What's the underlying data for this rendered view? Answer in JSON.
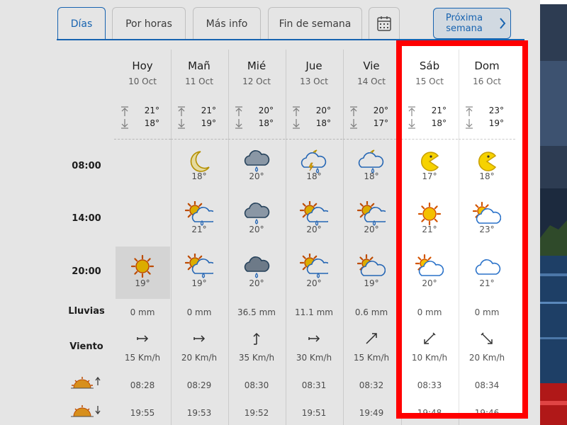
{
  "tabs": [
    {
      "label": "Días",
      "active": true
    },
    {
      "label": "Por horas"
    },
    {
      "label": "Más info"
    },
    {
      "label": "Fin de semana"
    }
  ],
  "next_week": {
    "line1": "Próxima",
    "line2": "semana"
  },
  "row_labels": {
    "h08": "08:00",
    "h14": "14:00",
    "h20": "20:00",
    "rain": "Lluvias",
    "wind": "Viento"
  },
  "days": [
    {
      "name": "Hoy",
      "date": "10 Oct",
      "max": "21°",
      "min": "18°",
      "t08": "",
      "t14": "",
      "t20": "19°",
      "rain": "0 mm",
      "wind": "15 Km/h",
      "sunrise": "08:28",
      "sunset": "19:55"
    },
    {
      "name": "Mañ",
      "date": "11 Oct",
      "max": "21°",
      "min": "19°",
      "t08": "18°",
      "t14": "21°",
      "t20": "19°",
      "rain": "0 mm",
      "wind": "20 Km/h",
      "sunrise": "08:29",
      "sunset": "19:53"
    },
    {
      "name": "Mié",
      "date": "12 Oct",
      "max": "20°",
      "min": "18°",
      "t08": "20°",
      "t14": "20°",
      "t20": "20°",
      "rain": "36.5 mm",
      "wind": "35 Km/h",
      "sunrise": "08:30",
      "sunset": "19:52"
    },
    {
      "name": "Jue",
      "date": "13 Oct",
      "max": "20°",
      "min": "18°",
      "t08": "18°",
      "t14": "20°",
      "t20": "20°",
      "rain": "11.1 mm",
      "wind": "30 Km/h",
      "sunrise": "08:31",
      "sunset": "19:51"
    },
    {
      "name": "Vie",
      "date": "14 Oct",
      "max": "20°",
      "min": "17°",
      "t08": "18°",
      "t14": "20°",
      "t20": "19°",
      "rain": "0.6 mm",
      "wind": "15 Km/h",
      "sunrise": "08:32",
      "sunset": "19:49"
    },
    {
      "name": "Sáb",
      "date": "15 Oct",
      "max": "21°",
      "min": "18°",
      "t08": "17°",
      "t14": "21°",
      "t20": "20°",
      "rain": "0 mm",
      "wind": "10 Km/h",
      "sunrise": "08:33",
      "sunset": "19:48"
    },
    {
      "name": "Dom",
      "date": "16 Oct",
      "max": "23°",
      "min": "19°",
      "t08": "18°",
      "t14": "23°",
      "t20": "21°",
      "rain": "0 mm",
      "wind": "20 Km/h",
      "sunrise": "08:34",
      "sunset": "19:46"
    }
  ],
  "colors": {
    "accent": "#1a6fc4",
    "highlight": "#ff0000"
  }
}
